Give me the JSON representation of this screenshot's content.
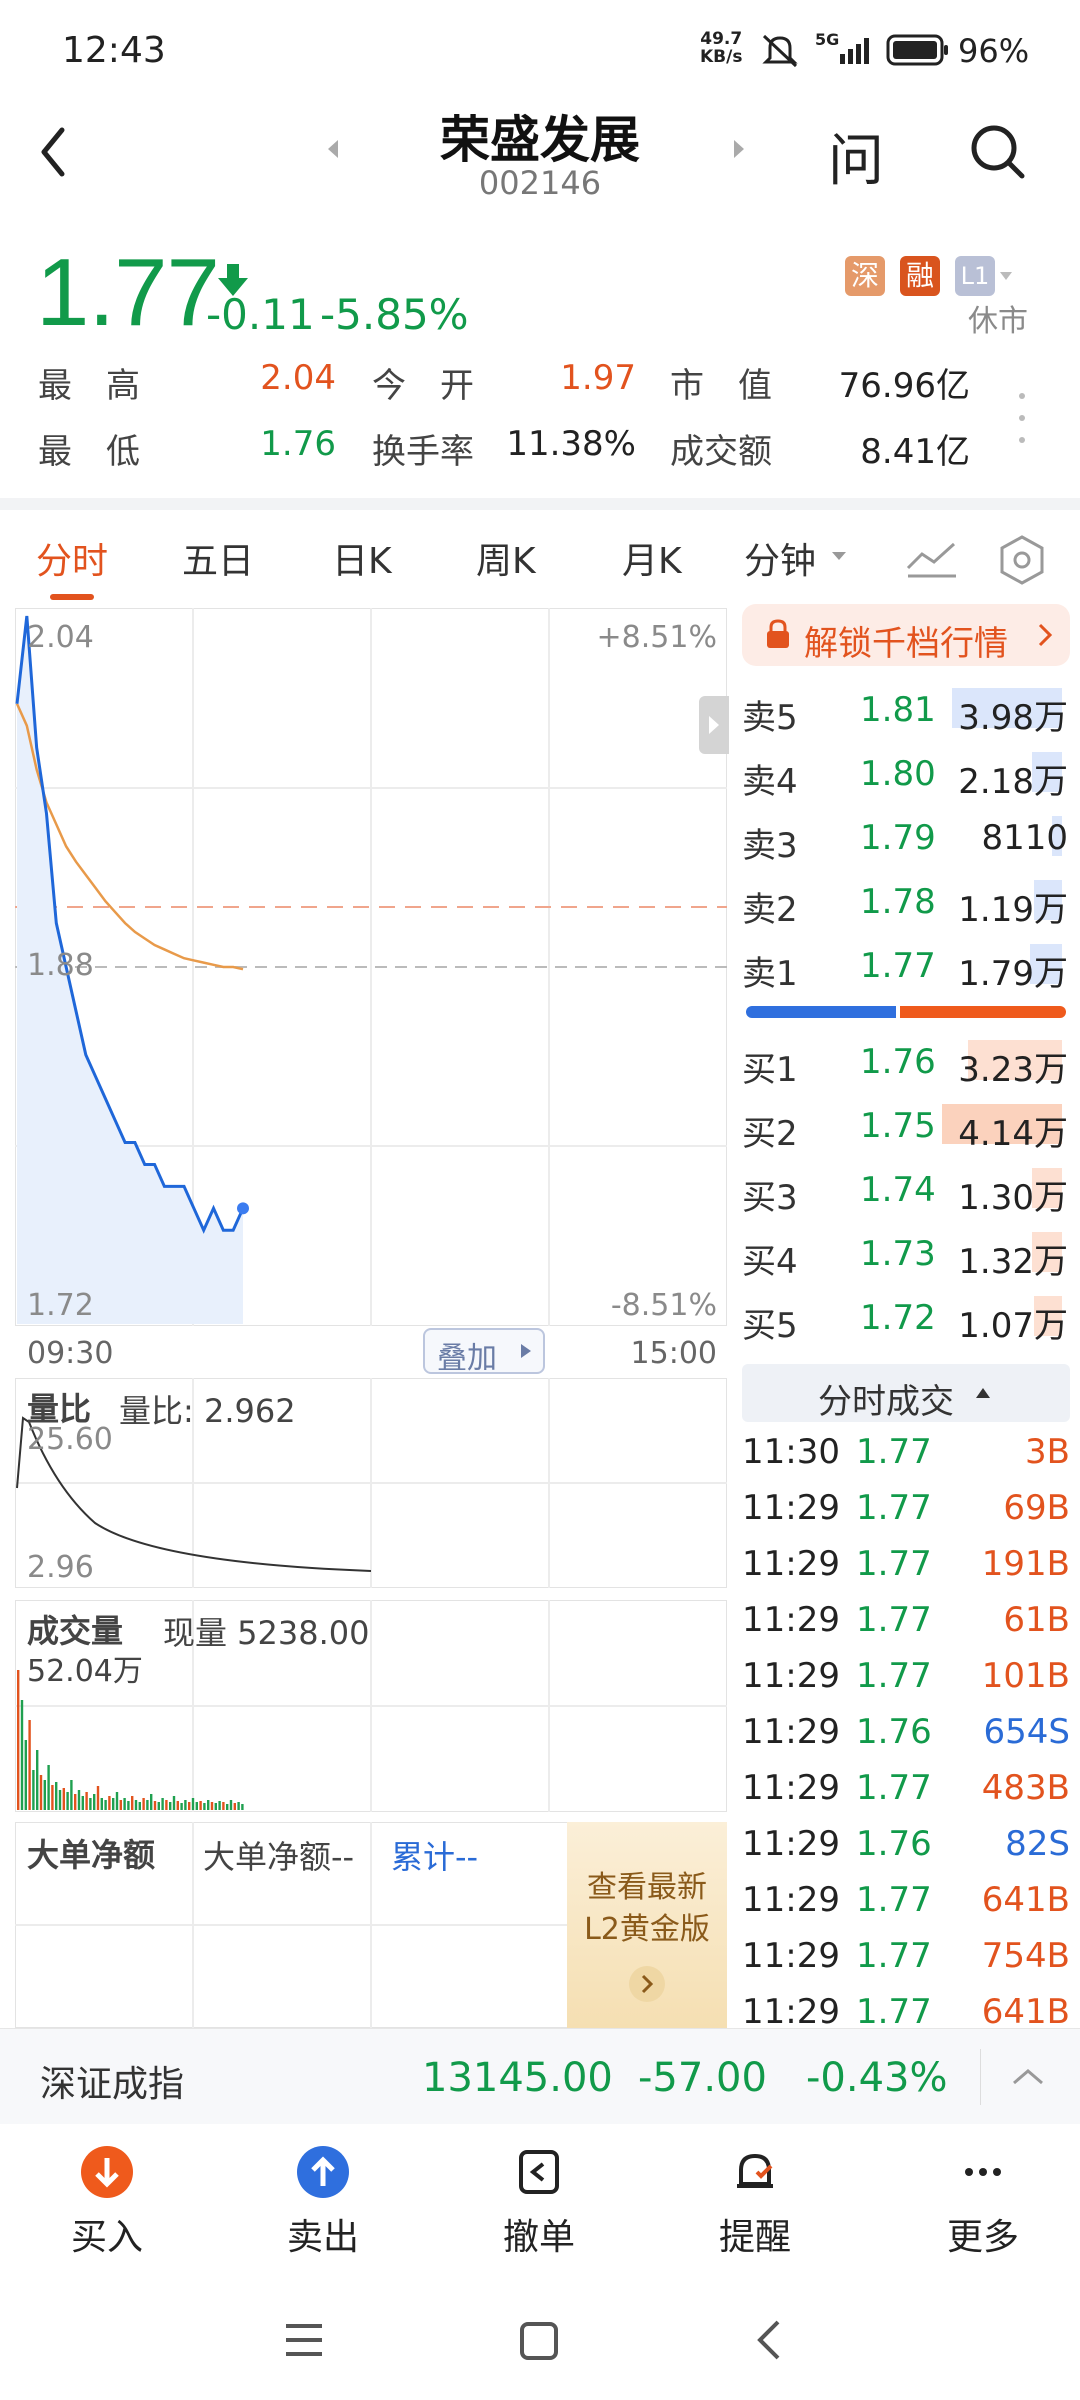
{
  "status": {
    "time": "12:43",
    "net_speed_top": "49.7",
    "net_speed_bottom": "KB/s",
    "network": "5G",
    "battery": "96%"
  },
  "header": {
    "name": "荣盛发展",
    "code": "002146",
    "ask_label": "问"
  },
  "quote": {
    "price": "1.77",
    "change": "-0.11",
    "change_pct": "-5.85%",
    "badges": [
      "深",
      "融",
      "L1"
    ],
    "market_state": "休市",
    "rows": [
      [
        {
          "label": "最　高",
          "value": "2.04",
          "color": "red"
        },
        {
          "label": "今　开",
          "value": "1.97",
          "color": "red"
        },
        {
          "label": "市　值",
          "value": "76.96亿",
          "color": "dark"
        }
      ],
      [
        {
          "label": "最　低",
          "value": "1.76",
          "color": "green"
        },
        {
          "label": "换手率",
          "value": "11.38%",
          "color": "dark"
        },
        {
          "label": "成交额",
          "value": "8.41亿",
          "color": "dark"
        }
      ]
    ]
  },
  "tabs": [
    "分时",
    "五日",
    "日K",
    "周K",
    "月K",
    "分钟"
  ],
  "chart": {
    "high_label": "2.04",
    "high_pct": "+8.51%",
    "prev_close_label": "1.88",
    "low_label": "1.72",
    "low_pct": "-8.51%",
    "time_start": "09:30",
    "time_end": "15:00",
    "overlay_btn": "叠加",
    "ratio_title": "量比",
    "ratio_text": "量比: 2.962",
    "ratio_max": "25.60",
    "ratio_min": "2.96",
    "vol_title": "成交量",
    "vol_text": "现量 5238.00",
    "vol_max": "52.04万",
    "bigorder_title": "大单净额",
    "bigorder_text": "大单净额--",
    "bigorder_cum": "累计--",
    "promo_line1": "查看最新",
    "promo_line2": "L2黄金版"
  },
  "chart_data": {
    "type": "line",
    "ylim": [
      1.72,
      2.04
    ],
    "prev_close": 1.88,
    "series": [
      {
        "values": [
          2.0,
          2.04,
          1.98,
          1.95,
          1.9,
          1.88,
          1.86,
          1.84,
          1.83,
          1.82,
          1.81,
          1.8,
          1.8,
          1.79,
          1.79,
          1.78,
          1.78,
          1.78,
          1.77,
          1.76,
          1.77,
          1.76,
          1.76,
          1.77
        ]
      },
      {
        "values": [
          2.0,
          1.99,
          1.97,
          1.955,
          1.945,
          1.935,
          1.928,
          1.922,
          1.916,
          1.91,
          1.905,
          1.9,
          1.896,
          1.893,
          1.89,
          1.888,
          1.886,
          1.884,
          1.883,
          1.882,
          1.881,
          1.88,
          1.88,
          1.879
        ]
      }
    ]
  },
  "orderbook": {
    "unlock_label": "解锁千档行情",
    "sell": [
      {
        "label": "卖5",
        "price": "1.81",
        "vol": "3.98万"
      },
      {
        "label": "卖4",
        "price": "1.80",
        "vol": "2.18万"
      },
      {
        "label": "卖3",
        "price": "1.79",
        "vol": "8110"
      },
      {
        "label": "卖2",
        "price": "1.78",
        "vol": "1.19万"
      },
      {
        "label": "卖1",
        "price": "1.77",
        "vol": "1.79万"
      }
    ],
    "buy": [
      {
        "label": "买1",
        "price": "1.76",
        "vol": "3.23万"
      },
      {
        "label": "买2",
        "price": "1.75",
        "vol": "4.14万"
      },
      {
        "label": "买3",
        "price": "1.74",
        "vol": "1.30万"
      },
      {
        "label": "买4",
        "price": "1.73",
        "vol": "1.32万"
      },
      {
        "label": "买5",
        "price": "1.72",
        "vol": "1.07万"
      }
    ]
  },
  "ticks": {
    "title": "分时成交",
    "rows": [
      {
        "time": "11:30",
        "price": "1.77",
        "vol": "3B"
      },
      {
        "time": "11:29",
        "price": "1.77",
        "vol": "69B"
      },
      {
        "time": "11:29",
        "price": "1.77",
        "vol": "191B"
      },
      {
        "time": "11:29",
        "price": "1.77",
        "vol": "61B"
      },
      {
        "time": "11:29",
        "price": "1.77",
        "vol": "101B"
      },
      {
        "time": "11:29",
        "price": "1.76",
        "vol": "654S"
      },
      {
        "time": "11:29",
        "price": "1.77",
        "vol": "483B"
      },
      {
        "time": "11:29",
        "price": "1.76",
        "vol": "82S"
      },
      {
        "time": "11:29",
        "price": "1.77",
        "vol": "641B"
      },
      {
        "time": "11:29",
        "price": "1.77",
        "vol": "754B"
      },
      {
        "time": "11:29",
        "price": "1.77",
        "vol": "641B"
      }
    ]
  },
  "index_bar": {
    "name": "深证成指",
    "value": "13145.00",
    "change": "-57.00",
    "pct": "-0.43%"
  },
  "bottom_nav": [
    "买入",
    "卖出",
    "撤单",
    "提醒",
    "更多"
  ]
}
